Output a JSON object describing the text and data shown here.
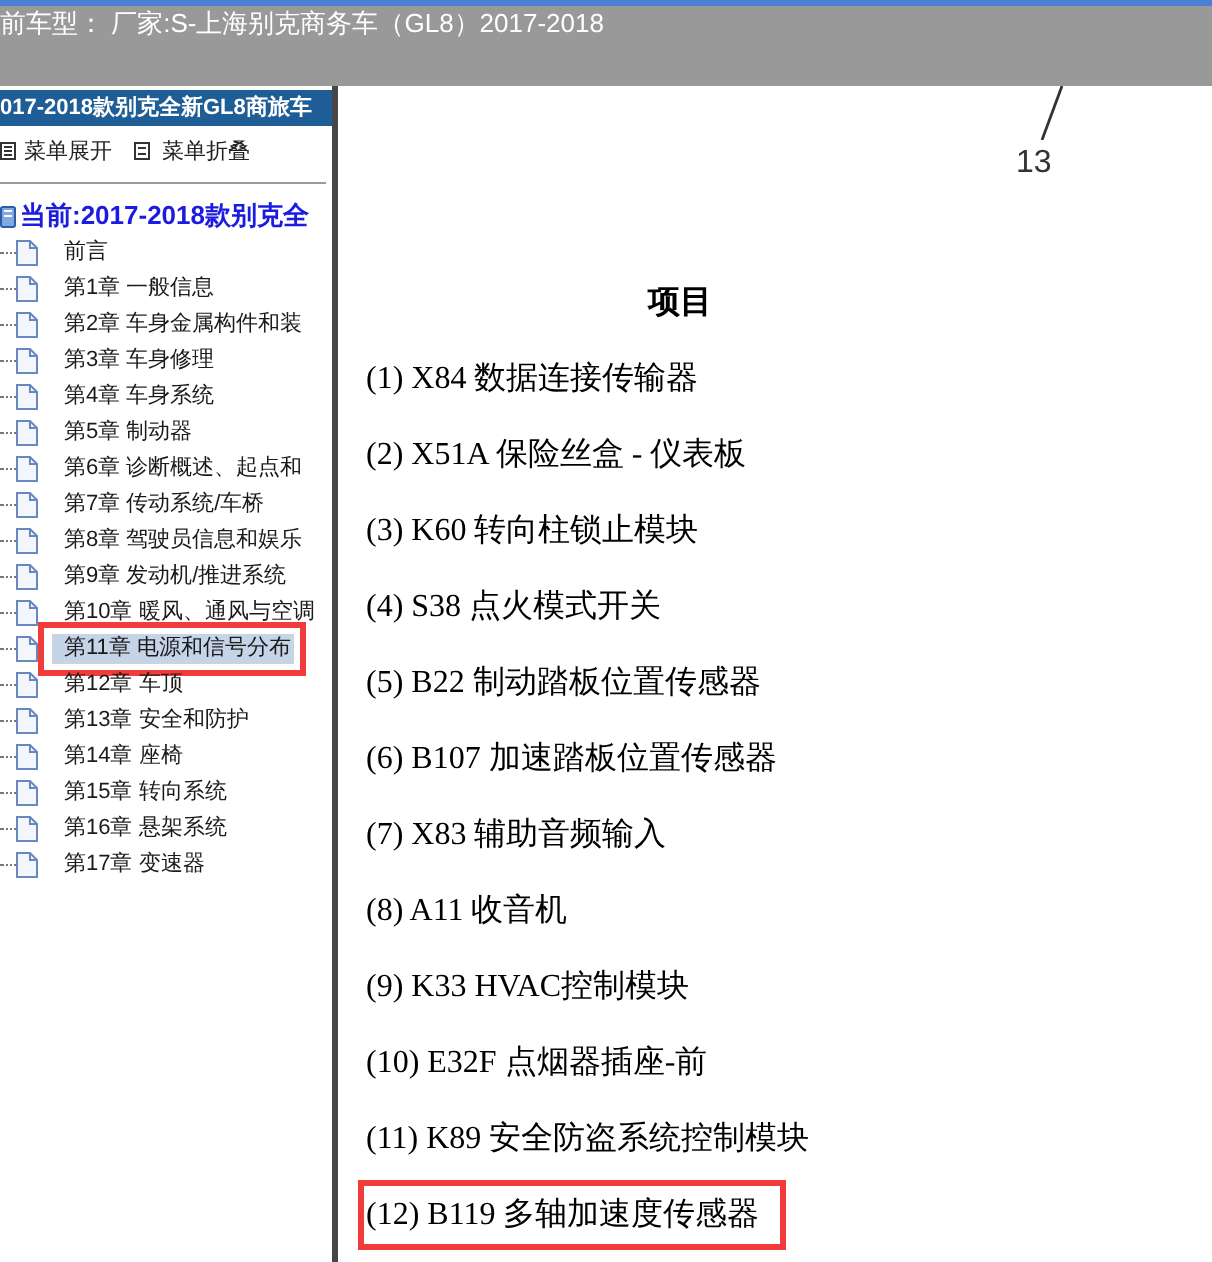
{
  "header": {
    "title": "前车型： 厂家:S-上海别克商务车（GL8）2017-2018"
  },
  "sidebar": {
    "title": "017-2018款别克全新GL8商旅车",
    "toolbar": [
      {
        "kind": "expand",
        "label": "菜单展开"
      },
      {
        "kind": "collapse",
        "label": "菜单折叠"
      }
    ],
    "tree": {
      "root": "当前:2017-2018款别克全",
      "items": [
        {
          "label": "前言",
          "selected": false,
          "highlighted": false
        },
        {
          "label": "第1章 一般信息",
          "selected": false,
          "highlighted": false
        },
        {
          "label": "第2章 车身金属构件和装",
          "selected": false,
          "highlighted": false
        },
        {
          "label": "第3章 车身修理",
          "selected": false,
          "highlighted": false
        },
        {
          "label": "第4章 车身系统",
          "selected": false,
          "highlighted": false
        },
        {
          "label": "第5章 制动器",
          "selected": false,
          "highlighted": false
        },
        {
          "label": "第6章 诊断概述、起点和",
          "selected": false,
          "highlighted": false
        },
        {
          "label": "第7章 传动系统/车桥",
          "selected": false,
          "highlighted": false
        },
        {
          "label": "第8章 驾驶员信息和娱乐",
          "selected": false,
          "highlighted": false
        },
        {
          "label": "第9章 发动机/推进系统",
          "selected": false,
          "highlighted": false
        },
        {
          "label": "第10章 暖风、通风与空调",
          "selected": false,
          "highlighted": false
        },
        {
          "label": "第11章 电源和信号分布",
          "selected": true,
          "highlighted": true
        },
        {
          "label": "第12章 车顶",
          "selected": false,
          "highlighted": false
        },
        {
          "label": "第13章 安全和防护",
          "selected": false,
          "highlighted": false
        },
        {
          "label": "第14章 座椅",
          "selected": false,
          "highlighted": false
        },
        {
          "label": "第15章 转向系统",
          "selected": false,
          "highlighted": false
        },
        {
          "label": "第16章 悬架系统",
          "selected": false,
          "highlighted": false
        },
        {
          "label": "第17章 变速器",
          "selected": false,
          "highlighted": false
        }
      ]
    }
  },
  "content": {
    "figure": {
      "callout": "13"
    },
    "heading": "项目",
    "items": [
      {
        "label": "(1) X84 数据连接传输器",
        "highlighted": false
      },
      {
        "label": "(2) X51A 保险丝盒 - 仪表板",
        "highlighted": false
      },
      {
        "label": "(3) K60 转向柱锁止模块",
        "highlighted": false
      },
      {
        "label": "(4) S38 点火模式开关",
        "highlighted": false
      },
      {
        "label": "(5) B22 制动踏板位置传感器",
        "highlighted": false
      },
      {
        "label": "(6) B107 加速踏板位置传感器",
        "highlighted": false
      },
      {
        "label": "(7) X83 辅助音频输入",
        "highlighted": false
      },
      {
        "label": "(8) A11 收音机",
        "highlighted": false
      },
      {
        "label": "(9) K33 HVAC控制模块",
        "highlighted": false
      },
      {
        "label": "(10) E32F 点烟器插座-前",
        "highlighted": false
      },
      {
        "label": "(11) K89 安全防盗系统控制模块",
        "highlighted": false
      },
      {
        "label": "(12) B119 多轴加速度传感器",
        "highlighted": true
      }
    ]
  }
}
